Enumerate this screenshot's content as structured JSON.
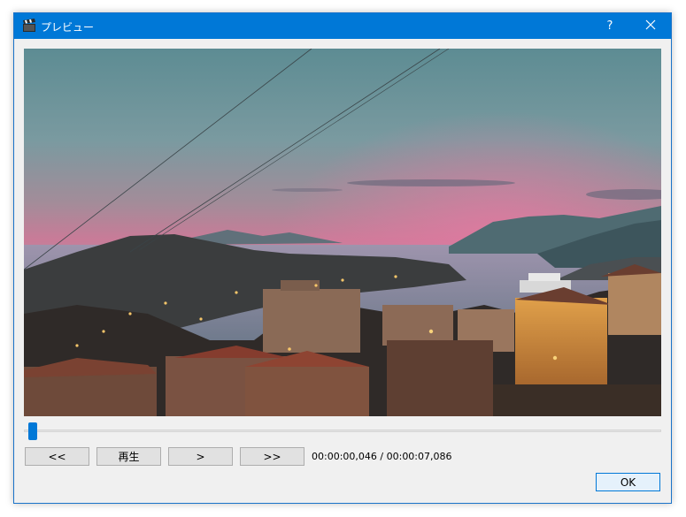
{
  "window": {
    "title": "プレビュー",
    "help_label": "?"
  },
  "controls": {
    "rewind_label": "<<",
    "play_label": "再生",
    "step_label": ">",
    "fast_forward_label": ">>",
    "current_time": "00:00:00,046",
    "separator": " / ",
    "total_time": "00:00:07,086",
    "seek_position_fraction": 0.0065
  },
  "dialog": {
    "ok_label": "OK"
  },
  "icons": {
    "app": "clapperboard-icon",
    "close": "close-icon"
  },
  "colors": {
    "titlebar": "#0078d7",
    "accent": "#0078d7",
    "dialog_bg": "#f0f0f0"
  }
}
